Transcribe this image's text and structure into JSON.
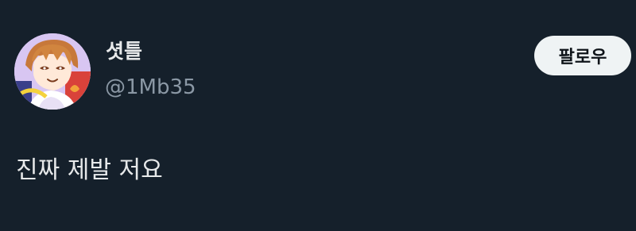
{
  "tweet": {
    "author": {
      "display_name": "셧틀",
      "handle": "@1Mb35",
      "avatar_icon": "avatar-illustration"
    },
    "follow_label": "팔로우",
    "text": "진짜 제발 저요"
  },
  "colors": {
    "background": "#15202b",
    "primary_text": "#e7e9ea",
    "secondary_text": "#8b98a5",
    "follow_button_bg": "#eff3f4"
  }
}
